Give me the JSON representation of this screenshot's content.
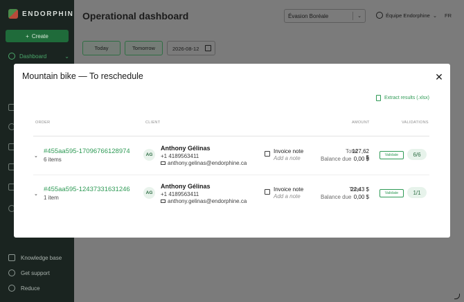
{
  "app": {
    "brand": "ENDORPHINE",
    "create_label": "Create",
    "nav_dashboard": "Dashboard"
  },
  "sidebar_bottom": {
    "knowledge": "Knowledge base",
    "support": "Get support",
    "reduce": "Reduce"
  },
  "header": {
    "title": "Operational dashboard",
    "org_select": "Évasion Boréale",
    "account": "Équipe Endorphine",
    "lang": "FR"
  },
  "filters": {
    "today": "Today",
    "tomorrow": "Tomorrow",
    "date": "2026-08-12"
  },
  "modal": {
    "title": "Mountain bike — To reschedule",
    "export_label": "Extract results (.xlsx)",
    "columns": {
      "order": "ORDER",
      "client": "CLIENT",
      "amount": "AMOUNT",
      "validations": "VALIDATIONS"
    },
    "rows": [
      {
        "order_id": "#455aa595-17096766128974",
        "items": "6 items",
        "initials": "AG",
        "client_name": "Anthony Gélinas",
        "phone": "+1 4189563411",
        "email": "anthony.gelinas@endorphine.ca",
        "note_title": "Invoice note",
        "note_add": "Add a note",
        "total_label": "Total",
        "total": "127,62 $",
        "balance_label": "Balance due",
        "balance": "0,00 $",
        "validate_label": "Validate",
        "validations": "6/6"
      },
      {
        "order_id": "#455aa595-12437331631246",
        "items": "1 item",
        "initials": "AG",
        "client_name": "Anthony Gélinas",
        "phone": "+1 4189563411",
        "email": "anthony.gelinas@endorphine.ca",
        "note_title": "Invoice note",
        "note_add": "Add a note",
        "total_label": "Total",
        "total": "22,43 $",
        "balance_label": "Balance due",
        "balance": "0,00 $",
        "validate_label": "Validate",
        "validations": "1/1"
      }
    ]
  }
}
